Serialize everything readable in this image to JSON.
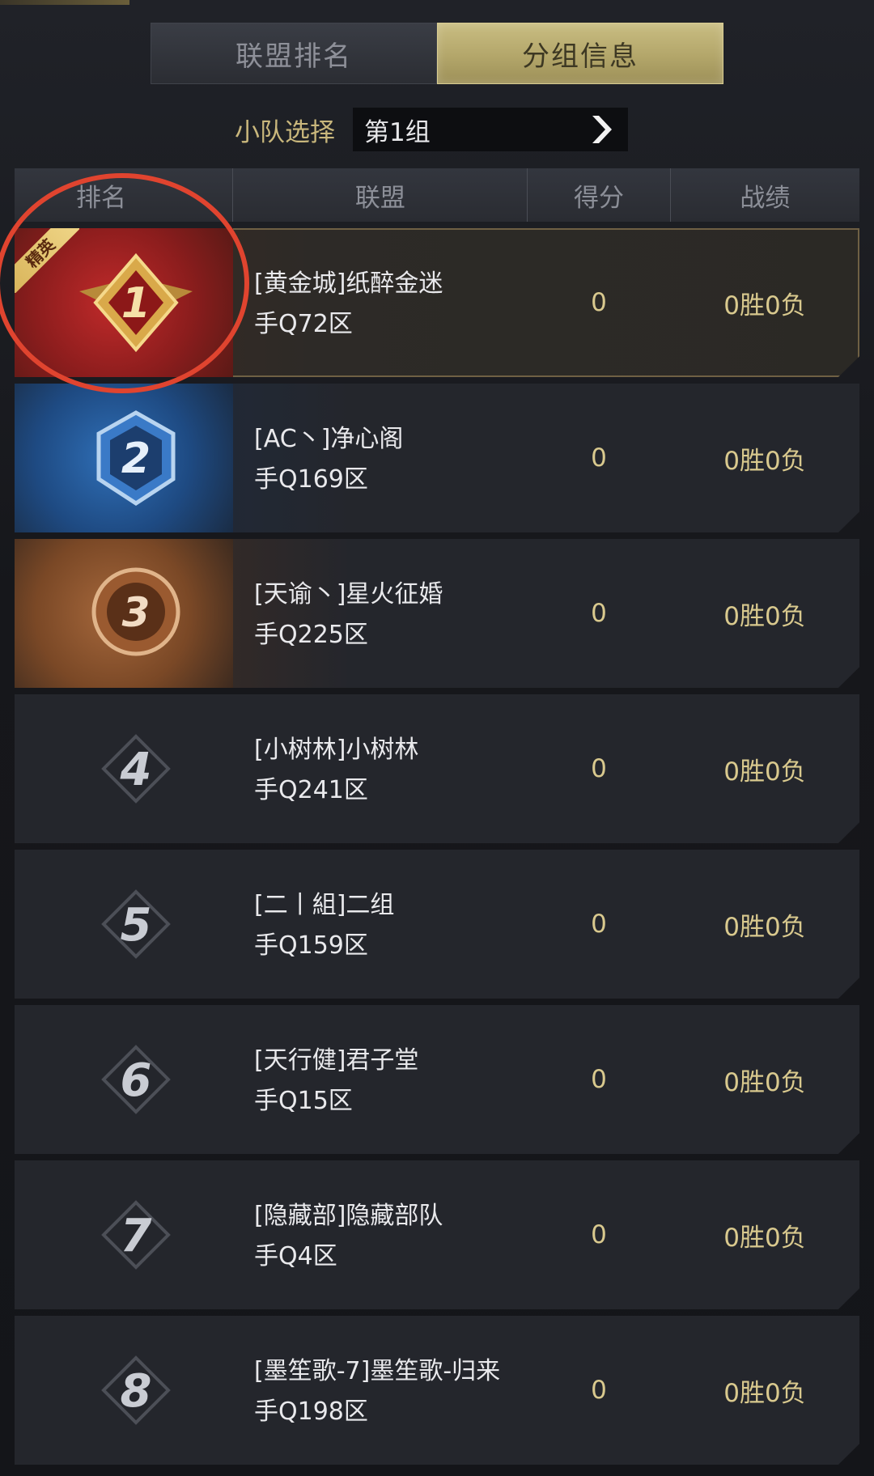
{
  "tabs": [
    {
      "label": "联盟排名",
      "active": false
    },
    {
      "label": "分组信息",
      "active": true
    }
  ],
  "team_select": {
    "label": "小队选择",
    "value": "第1组"
  },
  "table": {
    "headers": {
      "rank": "排名",
      "alliance": "联盟",
      "score": "得分",
      "record": "战绩"
    },
    "rows": [
      {
        "rank": "1",
        "alliance": "[黄金城]纸醉金迷",
        "server": "手Q72区",
        "score": "0",
        "record": "0胜0负",
        "tag": "精英"
      },
      {
        "rank": "2",
        "alliance": "[AC丶]净心阁",
        "server": "手Q169区",
        "score": "0",
        "record": "0胜0负"
      },
      {
        "rank": "3",
        "alliance": "[天谕丶]星火征婚",
        "server": "手Q225区",
        "score": "0",
        "record": "0胜0负"
      },
      {
        "rank": "4",
        "alliance": "[小树林]小树林",
        "server": "手Q241区",
        "score": "0",
        "record": "0胜0负"
      },
      {
        "rank": "5",
        "alliance": "[二丨組]二组",
        "server": "手Q159区",
        "score": "0",
        "record": "0胜0负"
      },
      {
        "rank": "6",
        "alliance": "[天行健]君子堂",
        "server": "手Q15区",
        "score": "0",
        "record": "0胜0负"
      },
      {
        "rank": "7",
        "alliance": "[隐藏部]隐藏部队",
        "server": "手Q4区",
        "score": "0",
        "record": "0胜0负"
      },
      {
        "rank": "8",
        "alliance": "[墨笙歌-7]墨笙歌-归来",
        "server": "手Q198区",
        "score": "0",
        "record": "0胜0负"
      }
    ]
  },
  "colors": {
    "accent_gold": "#c9bd82",
    "annotation_red": "#e0442f"
  }
}
